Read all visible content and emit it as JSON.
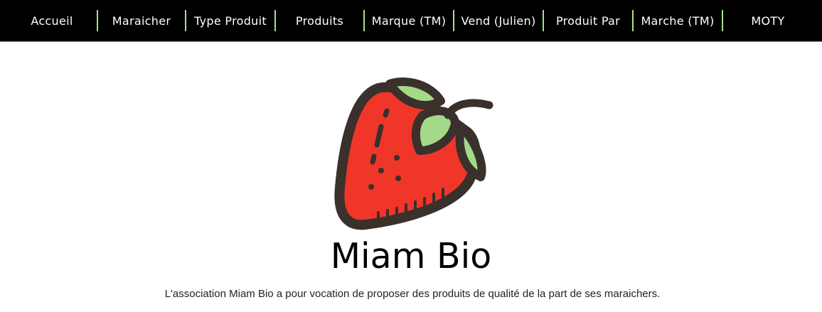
{
  "nav": {
    "items": [
      {
        "label": "Accueil"
      },
      {
        "label": "Maraicher"
      },
      {
        "label": "Type Produit"
      },
      {
        "label": "Produits"
      },
      {
        "label": "Marque (TM)"
      },
      {
        "label": "Vend (Julien)"
      },
      {
        "label": "Produit Par"
      },
      {
        "label": "Marche (TM)"
      },
      {
        "label": "MOTY"
      }
    ]
  },
  "hero": {
    "logo_icon": "strawberry-icon",
    "title": "Miam Bio",
    "tagline": "L'association Miam Bio a pour vocation de proposer des produits de qualité de la part de ses maraichers."
  },
  "colors": {
    "nav_bg": "#000000",
    "nav_separator": "#a8e08a",
    "strawberry_red": "#ef3629",
    "leaf_green": "#a3d989",
    "outline": "#3a302c"
  }
}
